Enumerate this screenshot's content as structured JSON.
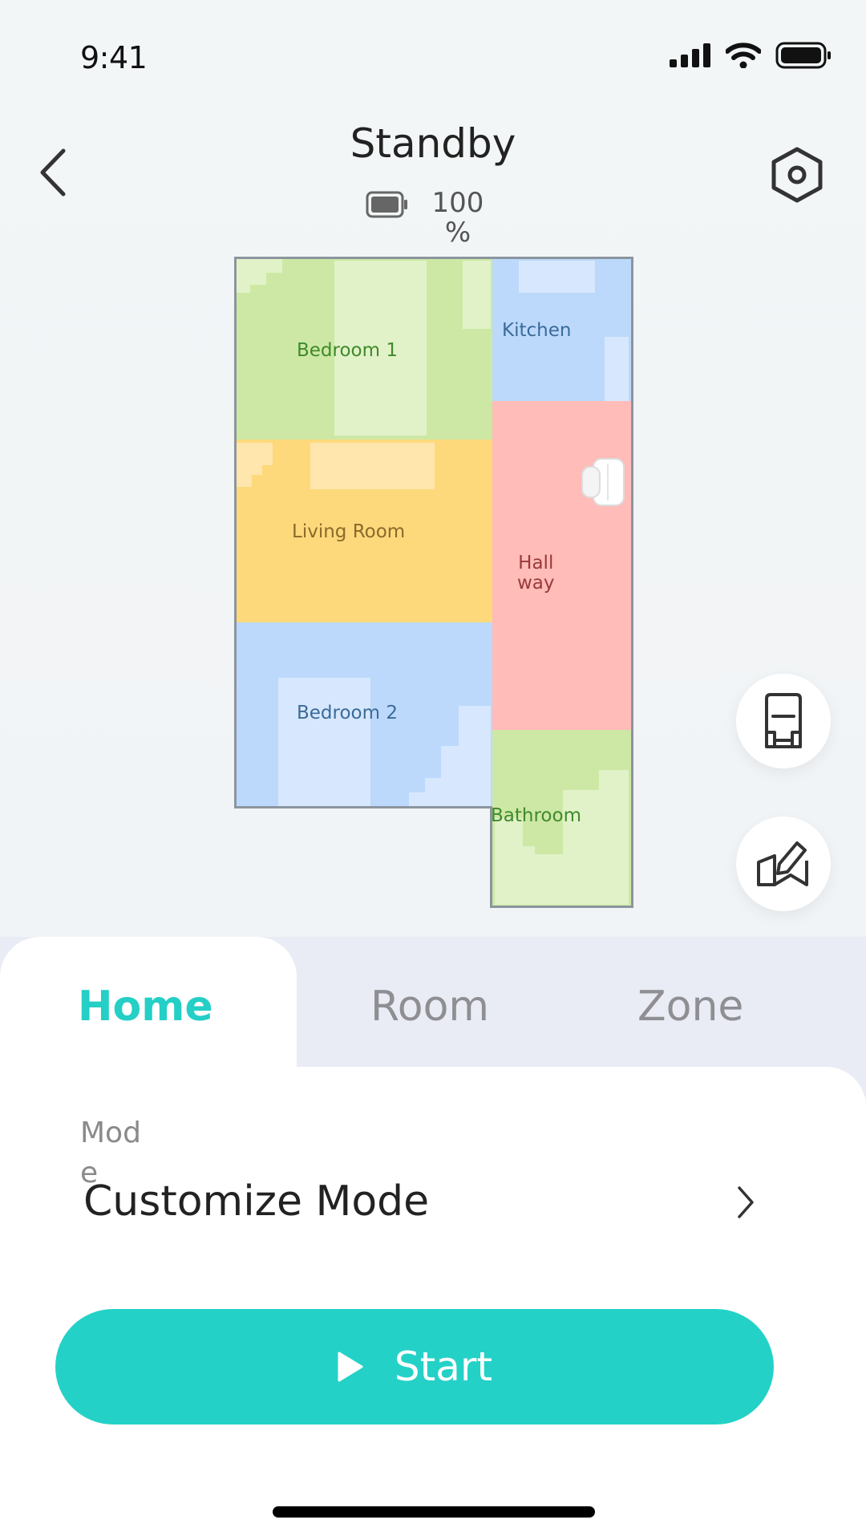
{
  "status_bar": {
    "time": "9:41"
  },
  "header": {
    "title": "Standby",
    "battery": "100 %",
    "battery_level": 1.0
  },
  "map": {
    "rooms": [
      {
        "name": "Bedroom 1",
        "color": "#cde8a5",
        "label_color": "#3f8a2b"
      },
      {
        "name": "Kitchen",
        "color": "#bcd9fb",
        "label_color": "#3a6b9a"
      },
      {
        "name": "Living Room",
        "color": "#fdd97c",
        "label_color": "#8a6a2a"
      },
      {
        "name": "Hall\nway",
        "color": "#ffbcb8",
        "label_color": "#9a3a3a"
      },
      {
        "name": "Bedroom 2",
        "color": "#bcd9fb",
        "label_color": "#3a6b9a"
      },
      {
        "name": "Bathroom",
        "color": "#cde8a5",
        "label_color": "#3f8a2b"
      }
    ]
  },
  "tabs": [
    {
      "label": "Home",
      "active": true
    },
    {
      "label": "Room",
      "active": false
    },
    {
      "label": "Zone",
      "active": false
    }
  ],
  "mode": {
    "label": "Mode",
    "value": "Customize Mode"
  },
  "start_button": {
    "label": "Start"
  },
  "colors": {
    "accent": "#24d1c7",
    "tab_inactive": "#8e8e93"
  }
}
